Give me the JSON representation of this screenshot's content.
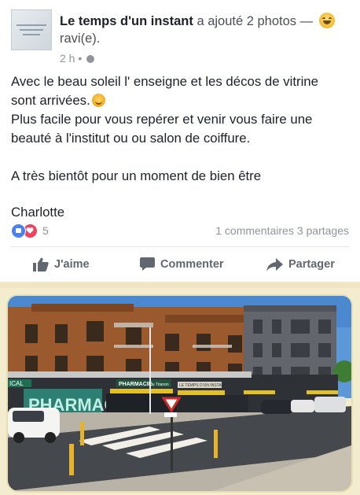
{
  "post": {
    "page_name": "Le temps d'un instant",
    "action_text": " a ajouté 2 photos — ",
    "feeling": "ravi(e).",
    "time": "2 h",
    "separator": " • ",
    "text_line1": "Avec le beau soleil l' enseigne et les décos de vitrine",
    "text_line2": "sont arrivées.",
    "text_line3": "Plus facile pour vous repérer et venir vous faire une",
    "text_line4": "beauté à l'institut ou ou salon de coiffure.",
    "text_line5": "A très bientôt pour un moment de bien être",
    "text_line6": "Charlotte"
  },
  "stats": {
    "reaction_count": "5",
    "comments": "1 commentaires",
    "shares": "3 partages"
  },
  "actions": {
    "like": "J'aime",
    "comment": "Commenter",
    "share": "Partager"
  },
  "photo": {
    "sign_left": "ICAL",
    "sign_center": "PHARMACIE",
    "sign_center2": "du Trianon",
    "sign_right": "LE TEMPS D'UN INSTANT",
    "window_text": "PHARMACIE"
  },
  "colors": {
    "accent": "#4267b2",
    "like": "#4a80f5",
    "love": "#f0425c"
  },
  "icons": [
    "avatar",
    "feeling-smile-icon",
    "globe-icon",
    "smile-icon",
    "like-reaction-icon",
    "love-reaction-icon",
    "thumbs-up-icon",
    "comment-icon",
    "share-icon"
  ]
}
